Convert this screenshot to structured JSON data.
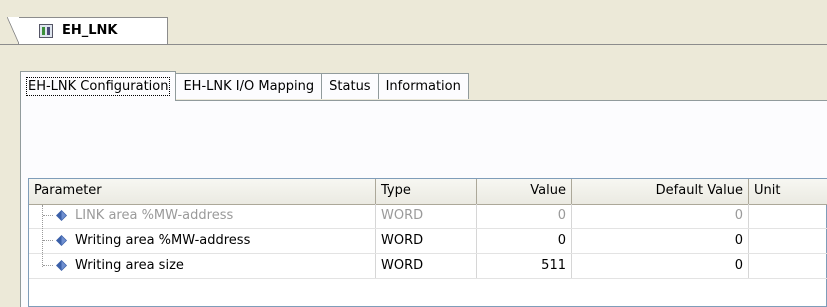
{
  "document_tab": {
    "icon": "device-module-icon",
    "label": "EH_LNK"
  },
  "tabs": [
    {
      "label": "EH-LNK Configuration",
      "active": true
    },
    {
      "label": "EH-LNK I/O Mapping",
      "active": false
    },
    {
      "label": "Status",
      "active": false
    },
    {
      "label": "Information",
      "active": false
    }
  ],
  "table": {
    "columns": [
      "Parameter",
      "Type",
      "Value",
      "Default Value",
      "Unit"
    ],
    "rows": [
      {
        "parameter": "LINK area %MW-address",
        "type": "WORD",
        "value": "0",
        "default_value": "0",
        "unit": "",
        "disabled": true
      },
      {
        "parameter": "Writing area %MW-address",
        "type": "WORD",
        "value": "0",
        "default_value": "0",
        "unit": "",
        "disabled": false
      },
      {
        "parameter": "Writing area size",
        "type": "WORD",
        "value": "511",
        "default_value": "0",
        "unit": "",
        "disabled": false
      }
    ]
  },
  "colors": {
    "param_icon": "#3a5fa8",
    "disabled_text": "#9a9a9a"
  }
}
